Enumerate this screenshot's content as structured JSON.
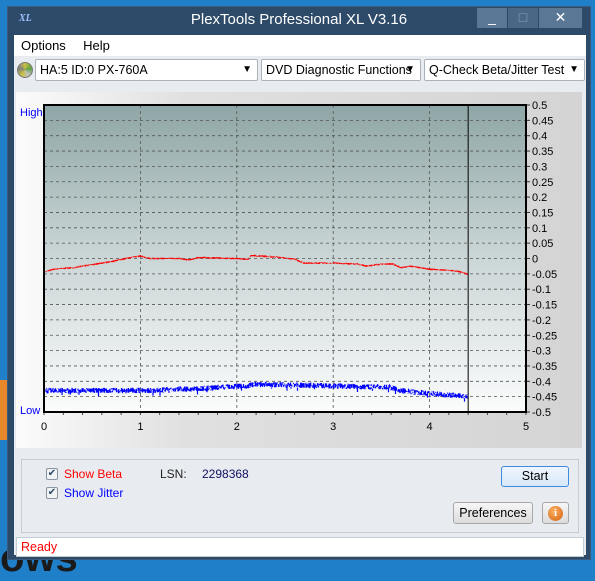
{
  "window": {
    "title": "PlexTools Professional XL V3.16",
    "logo": "XL",
    "minimize": "_",
    "maximize": "□",
    "close": "✕"
  },
  "menu": [
    "Options",
    "Help"
  ],
  "toolbar": {
    "drive": "HA:5 ID:0  PX-760A",
    "function": "DVD Diagnostic Functions",
    "test": "Q-Check Beta/Jitter Test",
    "drive_icon": "disc-icon"
  },
  "chart_data": {
    "type": "line",
    "xlim": [
      0,
      5
    ],
    "ylim": [
      -0.5,
      0.5
    ],
    "x_ticks": [
      "0",
      "1",
      "2",
      "3",
      "4",
      "5"
    ],
    "y_ticks": [
      "0.5",
      "0.45",
      "0.4",
      "0.35",
      "0.3",
      "0.25",
      "0.2",
      "0.15",
      "0.1",
      "0.05",
      "0",
      "-0.05",
      "-0.1",
      "-0.15",
      "-0.2",
      "-0.25",
      "-0.3",
      "-0.35",
      "-0.4",
      "-0.45",
      "-0.5"
    ],
    "left_labels": {
      "high": "High",
      "low": "Low"
    },
    "grid": true,
    "end_marker_x": 4.4,
    "series": [
      {
        "key": "beta",
        "color": "#ff0000",
        "points": [
          [
            0,
            -0.045
          ],
          [
            0.1,
            -0.035
          ],
          [
            0.3,
            -0.03
          ],
          [
            0.5,
            -0.02
          ],
          [
            0.7,
            -0.01
          ],
          [
            0.9,
            0.003
          ],
          [
            1.0,
            0.008
          ],
          [
            1.1,
            0.0
          ],
          [
            1.4,
            0.0
          ],
          [
            1.5,
            -0.005
          ],
          [
            1.6,
            0.003
          ],
          [
            2.0,
            0.0
          ],
          [
            2.12,
            -0.003
          ],
          [
            2.15,
            0.01
          ],
          [
            2.4,
            0.005
          ],
          [
            2.6,
            -0.002
          ],
          [
            2.7,
            -0.015
          ],
          [
            3.0,
            -0.015
          ],
          [
            3.25,
            -0.018
          ],
          [
            3.35,
            -0.025
          ],
          [
            3.5,
            -0.018
          ],
          [
            3.62,
            -0.018
          ],
          [
            3.7,
            -0.03
          ],
          [
            3.8,
            -0.025
          ],
          [
            4.0,
            -0.035
          ],
          [
            4.2,
            -0.038
          ],
          [
            4.3,
            -0.042
          ],
          [
            4.4,
            -0.052
          ]
        ]
      },
      {
        "key": "jitter",
        "color": "#0000ff",
        "points": [
          [
            0,
            -0.43
          ],
          [
            0.5,
            -0.43
          ],
          [
            1.0,
            -0.43
          ],
          [
            1.2,
            -0.43
          ],
          [
            1.3,
            -0.425
          ],
          [
            1.6,
            -0.425
          ],
          [
            1.8,
            -0.42
          ],
          [
            2.1,
            -0.415
          ],
          [
            2.2,
            -0.41
          ],
          [
            2.5,
            -0.412
          ],
          [
            3.0,
            -0.415
          ],
          [
            3.3,
            -0.418
          ],
          [
            3.6,
            -0.418
          ],
          [
            3.7,
            -0.43
          ],
          [
            4.0,
            -0.44
          ],
          [
            4.2,
            -0.445
          ],
          [
            4.4,
            -0.448
          ]
        ]
      }
    ]
  },
  "controls": {
    "show_beta": "Show Beta",
    "show_jitter": "Show Jitter",
    "show_beta_checked": true,
    "show_jitter_checked": true,
    "lsn_label": "LSN:",
    "lsn_value": "2298368",
    "start": "Start",
    "preferences": "Preferences",
    "info_icon": "info-icon",
    "beta_color": "#ff0000",
    "jitter_color": "#0000ff"
  },
  "status": "Ready"
}
